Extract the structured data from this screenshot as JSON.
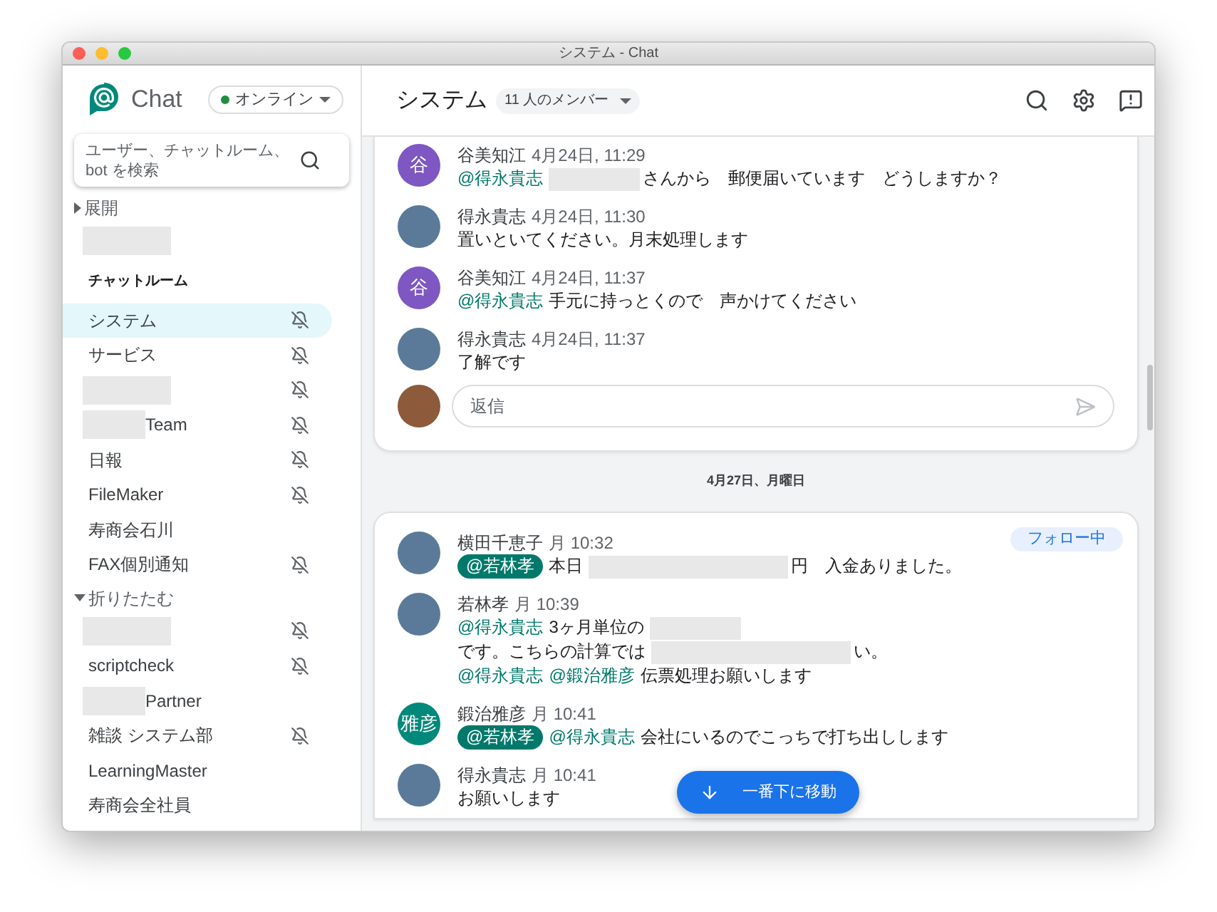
{
  "window": {
    "title": "システム - Chat"
  },
  "sidebar": {
    "app_name": "Chat",
    "status": {
      "label": "オンライン",
      "online": true
    },
    "search": {
      "placeholder": "ユーザー、チャットルーム、bot を検索"
    },
    "entries": [
      {
        "kind": "toggle",
        "label": "展開",
        "expanded": false
      },
      {
        "kind": "room",
        "redacted": true,
        "muted": false,
        "selected": false
      },
      {
        "kind": "heading",
        "label": "チャットルーム"
      },
      {
        "kind": "room",
        "label": "システム",
        "muted": true,
        "selected": true
      },
      {
        "kind": "room",
        "label": "サービス",
        "muted": true,
        "selected": false
      },
      {
        "kind": "room",
        "redacted": true,
        "muted": true,
        "selected": false
      },
      {
        "kind": "room",
        "redacted": true,
        "label": "Team",
        "muted": true,
        "selected": false
      },
      {
        "kind": "room",
        "label": "日報",
        "muted": true,
        "selected": false
      },
      {
        "kind": "room",
        "label": "FileMaker",
        "muted": true,
        "selected": false
      },
      {
        "kind": "room",
        "label": "寿商会石川",
        "muted": false,
        "selected": false
      },
      {
        "kind": "room",
        "label": "FAX個別通知",
        "muted": true,
        "selected": false
      },
      {
        "kind": "toggle",
        "label": "折りたたむ",
        "expanded": true
      },
      {
        "kind": "room",
        "redacted": true,
        "muted": true,
        "selected": false
      },
      {
        "kind": "room",
        "label": "scriptcheck",
        "muted": true,
        "selected": false
      },
      {
        "kind": "room",
        "redacted": true,
        "label": "Partner",
        "muted": false,
        "selected": false
      },
      {
        "kind": "room",
        "label": "雑談 システム部",
        "muted": true,
        "selected": false
      },
      {
        "kind": "room",
        "label": "LearningMaster",
        "muted": false,
        "selected": false
      },
      {
        "kind": "room",
        "label": "寿商会全社員",
        "muted": false,
        "selected": false
      }
    ]
  },
  "header": {
    "title": "システム",
    "members": "11 人のメンバー"
  },
  "threads": [
    {
      "messages": [
        {
          "name": "谷美知江",
          "time": "4月24日, 11:29",
          "avatar": {
            "kind": "letter",
            "text": "谷",
            "color": "#7e57c2"
          },
          "lines": [
            [
              {
                "kind": "mention",
                "text": "@得永貴志"
              },
              {
                "kind": "redacted"
              },
              {
                "kind": "text",
                "text": "さんから　郵便届いています　どうしますか？"
              }
            ]
          ]
        },
        {
          "name": "得永貴志",
          "time": "4月24日, 11:30",
          "avatar": {
            "kind": "photo"
          },
          "lines": [
            [
              {
                "kind": "text",
                "text": "置いといてください。月末処理します"
              }
            ]
          ]
        },
        {
          "name": "谷美知江",
          "time": "4月24日, 11:37",
          "avatar": {
            "kind": "letter",
            "text": "谷",
            "color": "#7e57c2"
          },
          "lines": [
            [
              {
                "kind": "mention",
                "text": "@得永貴志"
              },
              {
                "kind": "text",
                "text": "手元に持っとくので　声かけてください"
              }
            ]
          ]
        },
        {
          "name": "得永貴志",
          "time": "4月24日, 11:37",
          "avatar": {
            "kind": "photo"
          },
          "lines": [
            [
              {
                "kind": "text",
                "text": "了解です"
              }
            ]
          ]
        }
      ],
      "reply": {
        "placeholder": "返信"
      }
    },
    {
      "date": "4月27日、月曜日",
      "badge": "フォロー中",
      "messages": [
        {
          "name": "横田千恵子",
          "time": "月 10:32",
          "avatar": {
            "kind": "photo"
          },
          "lines": [
            [
              {
                "kind": "chip",
                "text": "@若林孝"
              },
              {
                "kind": "text",
                "text": "本日"
              },
              {
                "kind": "redacted",
                "wide": true
              },
              {
                "kind": "text",
                "text": "円　入金ありました。"
              }
            ]
          ]
        },
        {
          "name": "若林孝",
          "time": "月 10:39",
          "avatar": {
            "kind": "photo"
          },
          "lines": [
            [
              {
                "kind": "mention",
                "text": "@得永貴志"
              },
              {
                "kind": "text",
                "text": "3ヶ月単位の"
              },
              {
                "kind": "redacted"
              }
            ],
            [
              {
                "kind": "text",
                "text": "です。こちらの計算では"
              },
              {
                "kind": "redacted",
                "wide": true
              },
              {
                "kind": "text",
                "text": "い。"
              }
            ],
            [
              {
                "kind": "mention",
                "text": "@得永貴志"
              },
              {
                "kind": "mention",
                "text": "@鍛治雅彦"
              },
              {
                "kind": "text",
                "text": "伝票処理お願いします"
              }
            ]
          ]
        },
        {
          "name": "鍛治雅彦",
          "time": "月 10:41",
          "avatar": {
            "kind": "letter",
            "text": "雅彦",
            "color": "#00897b"
          },
          "lines": [
            [
              {
                "kind": "chip",
                "text": "@若林孝"
              },
              {
                "kind": "mention",
                "text": "@得永貴志"
              },
              {
                "kind": "text",
                "text": "会社にいるのでこっちで打ち出しします"
              }
            ]
          ]
        },
        {
          "name": "得永貴志",
          "time": "月 10:41",
          "avatar": {
            "kind": "photo"
          },
          "lines": [
            [
              {
                "kind": "text",
                "text": "お願いします"
              }
            ]
          ]
        }
      ]
    }
  ],
  "jump_button": {
    "label": "一番下に移動"
  }
}
